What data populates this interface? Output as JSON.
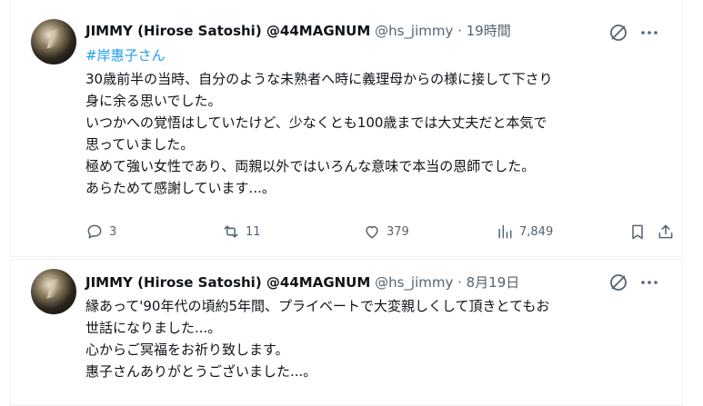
{
  "tweets": [
    {
      "name": "JIMMY (Hirose Satoshi) @44MAGNUM",
      "meta": "@hs_jimmy · 19時間",
      "hashtag": "#岸惠子さん",
      "lines": [
        "30歳前半の当時、自分のような未熟者へ時に義理母からの様に接して下さり",
        "身に余る思いでした。",
        "いつかへの覚悟はしていたけど、少なくとも100歳までは大丈夫だと本気で",
        "思っていました。",
        "極めて強い女性であり、両親以外ではいろんな意味で本当の恩師でした。",
        "あらためて感謝しています...。"
      ],
      "actions": {
        "reply": "3",
        "retweet": "11",
        "like": "379",
        "views": "7,849"
      }
    },
    {
      "name": "JIMMY (Hirose Satoshi) @44MAGNUM",
      "meta": "@hs_jimmy · 8月19日",
      "lines": [
        "縁あって'90年代の頃約5年間、プライベートで大変親しくして頂きとてもお",
        "世話になりました...。",
        "心からご冥福をお祈り致します。",
        "惠子さんありがとうございました...。"
      ]
    }
  ],
  "colors": {
    "link": "#1d9bf0",
    "muted": "#536471",
    "text": "#0f1419",
    "border": "#eff3f4"
  },
  "icons": [
    "grok-icon",
    "more-icon",
    "reply-icon",
    "retweet-icon",
    "like-icon",
    "views-icon",
    "bookmark-icon",
    "share-icon"
  ]
}
